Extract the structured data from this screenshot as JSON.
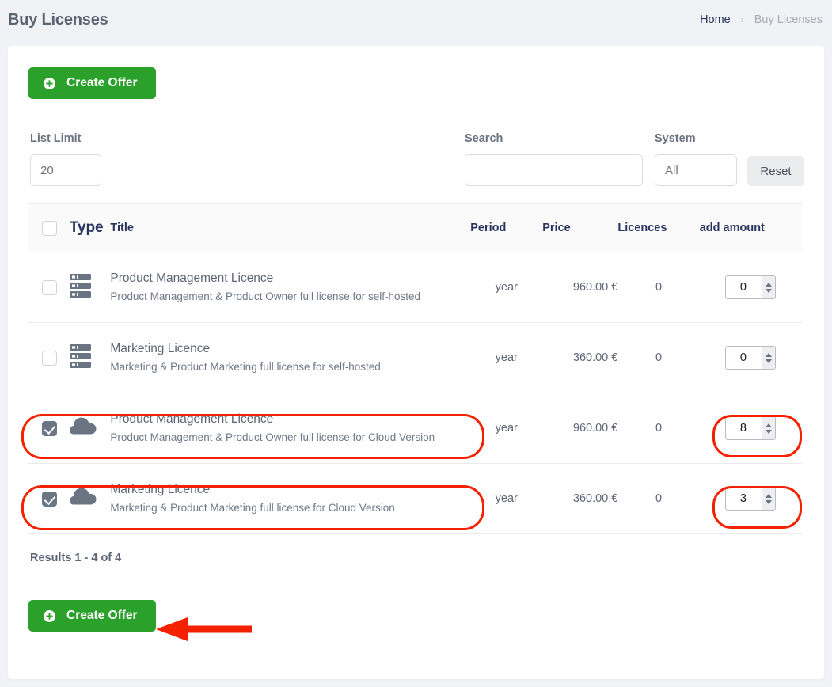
{
  "header": {
    "title": "Buy Licenses",
    "breadcrumb": {
      "home": "Home",
      "separator": "›",
      "current": "Buy Licenses"
    }
  },
  "toolbar": {
    "create_offer_label": "Create Offer",
    "plus_icon": "plus-circle-icon"
  },
  "filters": {
    "list_limit": {
      "label": "List Limit",
      "value": "20"
    },
    "search": {
      "label": "Search",
      "value": "",
      "placeholder": ""
    },
    "system": {
      "label": "System",
      "value": "All",
      "options": [
        "All"
      ]
    },
    "reset_label": "Reset"
  },
  "table": {
    "columns": {
      "select": "",
      "type": "Type",
      "title": "Title",
      "period": "Period",
      "price": "Price",
      "licences": "Licences",
      "add_amount": "add amount"
    },
    "rows": [
      {
        "checked": false,
        "icon": "server-icon",
        "title": "Product Management Licence",
        "subtitle": "Product Management & Product Owner full license for self-hosted",
        "period": "year",
        "price": "960.00 €",
        "licences": "0",
        "amount": "0"
      },
      {
        "checked": false,
        "icon": "server-icon",
        "title": "Marketing Licence",
        "subtitle": "Marketing & Product Marketing full license for self-hosted",
        "period": "year",
        "price": "360.00 €",
        "licences": "0",
        "amount": "0"
      },
      {
        "checked": true,
        "icon": "cloud-icon",
        "title": "Product Management Licence",
        "subtitle": "Product Management & Product Owner full license for Cloud Version",
        "period": "year",
        "price": "960.00 €",
        "licences": "0",
        "amount": "8"
      },
      {
        "checked": true,
        "icon": "cloud-icon",
        "title": "Marketing Licence",
        "subtitle": "Marketing & Product Marketing full license for Cloud Version",
        "period": "year",
        "price": "360.00 €",
        "licences": "0",
        "amount": "3"
      }
    ]
  },
  "footer": {
    "results": "Results 1 - 4 of 4",
    "create_offer_label": "Create Offer"
  },
  "annotations": {
    "color": "#f32100",
    "highlight_count": 4,
    "arrow": "left-arrow-pointing-to-create-offer"
  },
  "colors": {
    "primary_green": "#2ba02b",
    "breadcrumb_link": "#27335c",
    "header_text": "#5a6472",
    "annotation_red": "#f32100",
    "page_background": "#f1f2f6"
  }
}
